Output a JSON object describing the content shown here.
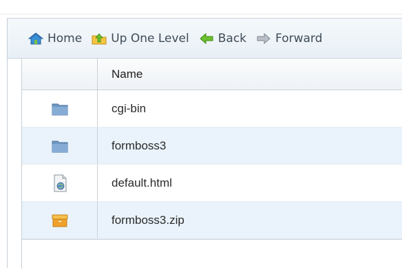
{
  "toolbar": {
    "home_label": "Home",
    "up_label": "Up One Level",
    "back_label": "Back",
    "forward_label": "Forward"
  },
  "table": {
    "name_header": "Name",
    "rows": [
      {
        "name": "cgi-bin",
        "icon": "folder-icon"
      },
      {
        "name": "formboss3",
        "icon": "folder-icon"
      },
      {
        "name": "default.html",
        "icon": "html-file-icon"
      },
      {
        "name": "formboss3.zip",
        "icon": "archive-icon"
      }
    ]
  },
  "colors": {
    "toolbar_bg": "#eaf1f7",
    "row_alt": "#eaf3fb",
    "folder_blue": "#6f97c4",
    "back_arrow": "#6cbf2e",
    "archive_orange": "#f0a12a"
  }
}
